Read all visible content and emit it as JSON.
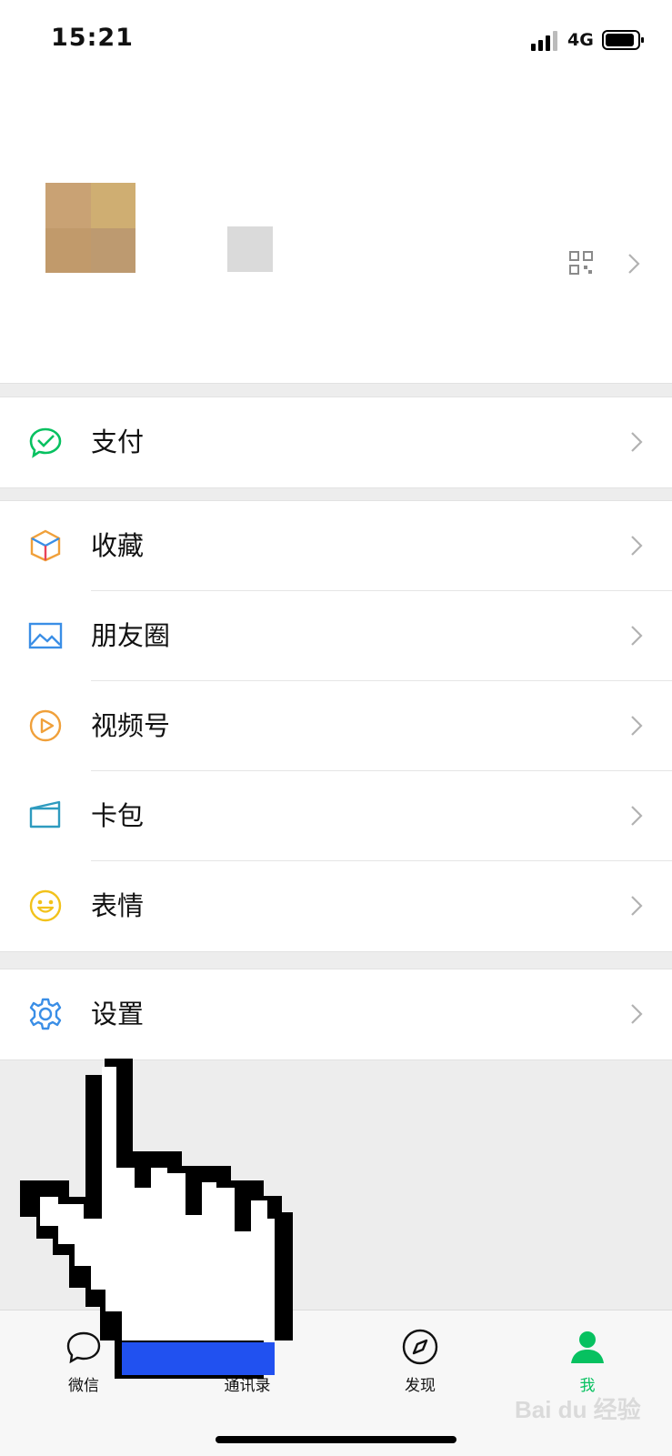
{
  "status_bar": {
    "time": "15:21",
    "network": "4G"
  },
  "menu_groups": [
    [
      {
        "label": "支付",
        "icon": "pay-icon"
      }
    ],
    [
      {
        "label": "收藏",
        "icon": "favorites-icon"
      },
      {
        "label": "朋友圈",
        "icon": "moments-icon"
      },
      {
        "label": "视频号",
        "icon": "channels-icon"
      },
      {
        "label": "卡包",
        "icon": "card-wallet-icon"
      },
      {
        "label": "表情",
        "icon": "emoji-icon"
      }
    ],
    [
      {
        "label": "设置",
        "icon": "settings-icon"
      }
    ]
  ],
  "tab_bar": {
    "tabs": [
      {
        "label": "微信",
        "icon": "chats-icon"
      },
      {
        "label": "通讯录",
        "icon": "contacts-icon"
      },
      {
        "label": "发现",
        "icon": "discover-icon"
      },
      {
        "label": "我",
        "icon": "me-icon",
        "active": true
      }
    ]
  },
  "watermark": "Bai du 经验",
  "colors": {
    "accent": "#07c160",
    "background": "#ededed",
    "cursor_fill": "#2151f0"
  }
}
